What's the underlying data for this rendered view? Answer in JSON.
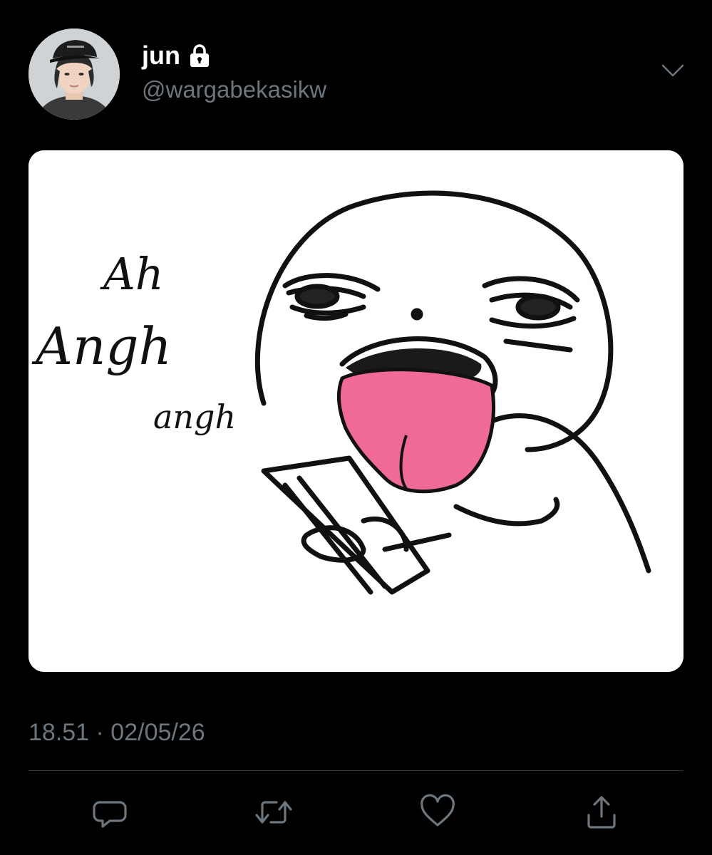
{
  "tweet": {
    "display_name": "jun",
    "handle": "@wargabekasikw",
    "protected_icon": "lock-icon",
    "more_icon": "chevron-down-icon",
    "timestamp": "18.51 · 02/05/26"
  },
  "media": {
    "drawing_text_lines": [
      "Ah",
      "Angh",
      "angh"
    ]
  },
  "actions": [
    {
      "name": "reply-button",
      "icon": "speech-bubble-icon"
    },
    {
      "name": "retweet-button",
      "icon": "retweet-arrows-icon"
    },
    {
      "name": "like-button",
      "icon": "heart-icon"
    },
    {
      "name": "share-button",
      "icon": "share-upload-icon"
    }
  ],
  "colors": {
    "background": "#000000",
    "primary_text": "#ffffff",
    "secondary_text": "#6e767d",
    "divider": "#2f3336",
    "tongue_pink": "#f06a97"
  }
}
